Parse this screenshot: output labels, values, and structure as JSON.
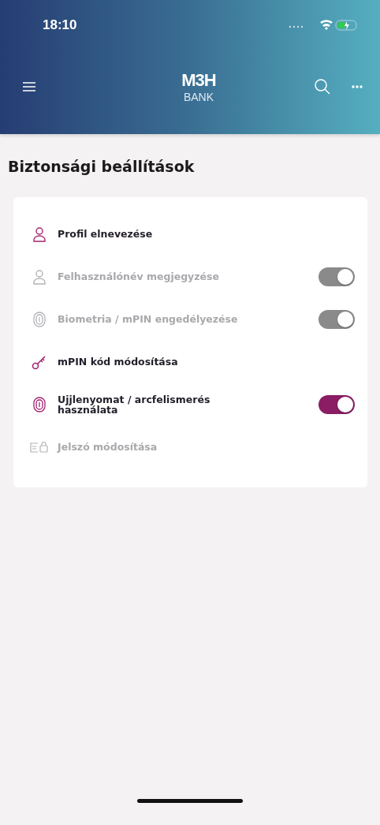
{
  "status_bar": {
    "time": "18:10"
  },
  "header": {
    "logo_top": "M3H",
    "logo_bottom": "BANK"
  },
  "page_title": "Biztonsági beállítások",
  "settings": [
    {
      "kind": "link",
      "label": "Profil elnevezése",
      "disabled": false
    },
    {
      "kind": "toggle",
      "label": "Felhasználónév megjegyzése",
      "disabled": true,
      "on": true
    },
    {
      "kind": "toggle",
      "label": "Biometria / mPIN engedélyezése",
      "disabled": true,
      "on": true
    },
    {
      "kind": "link",
      "label": "mPIN kód módosítása",
      "disabled": false
    },
    {
      "kind": "toggle",
      "label": "Ujjlenyomat / arcfelismerés használata",
      "disabled": false,
      "on": true
    },
    {
      "kind": "link",
      "label": "Jelszó módosítása",
      "disabled": true
    }
  ]
}
